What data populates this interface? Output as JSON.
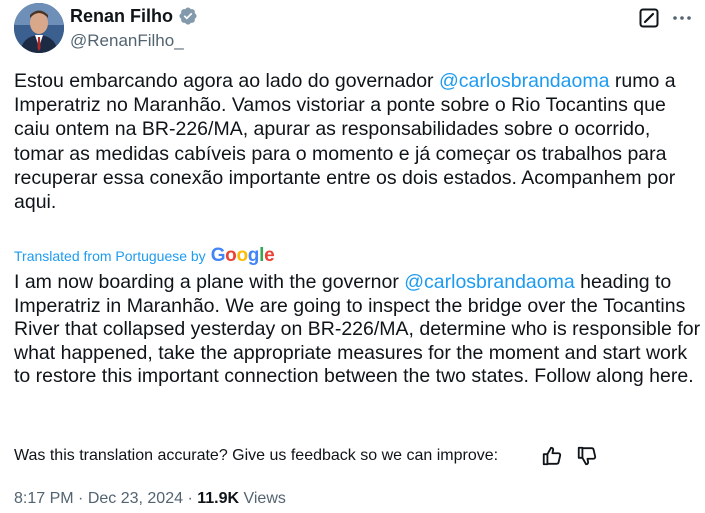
{
  "author": {
    "display_name": "Renan Filho",
    "handle": "@RenanFilho_"
  },
  "icons": {
    "verified": "verified-badge-icon",
    "grok": "grok-icon",
    "more": "more-options-icon",
    "thumb_up": "thumbs-up-icon",
    "thumb_down": "thumbs-down-icon"
  },
  "tweet": {
    "text_part1": "Estou embarcando agora ao lado do governador ",
    "mention": "@carlosbrandaoma",
    "text_part2": " rumo a Imperatriz no Maranhão. Vamos vistoriar a ponte sobre o Rio Tocantins que caiu ontem na BR-226/MA, apurar as responsabilidades sobre o ocorrido, tomar as medidas cabíveis para o momento e já começar os trabalhos para recuperar essa conexão importante entre os dois estados. Acompanhem por aqui."
  },
  "translation": {
    "label": "Translated from Portuguese by",
    "provider": "Google",
    "text_part1": "I am now boarding a plane with the governor ",
    "mention": "@carlosbrandaoma",
    "text_part2": " heading to Imperatriz in Maranhão. We are going to inspect the bridge over the Tocantins River that collapsed yesterday on BR-226/MA, determine who is responsible for what happened, take the appropriate measures for the moment and start work to restore this important connection between the two states. Follow along here.",
    "feedback_prompt": "Was this translation accurate? Give us feedback so we can improve:"
  },
  "meta": {
    "time": "8:17 PM",
    "separator": " · ",
    "date": "Dec 23, 2024",
    "views_count": "11.9K",
    "views_label": " Views"
  },
  "colors": {
    "link": "#1d9bf0",
    "text": "#0f1419",
    "secondary": "#536471"
  }
}
